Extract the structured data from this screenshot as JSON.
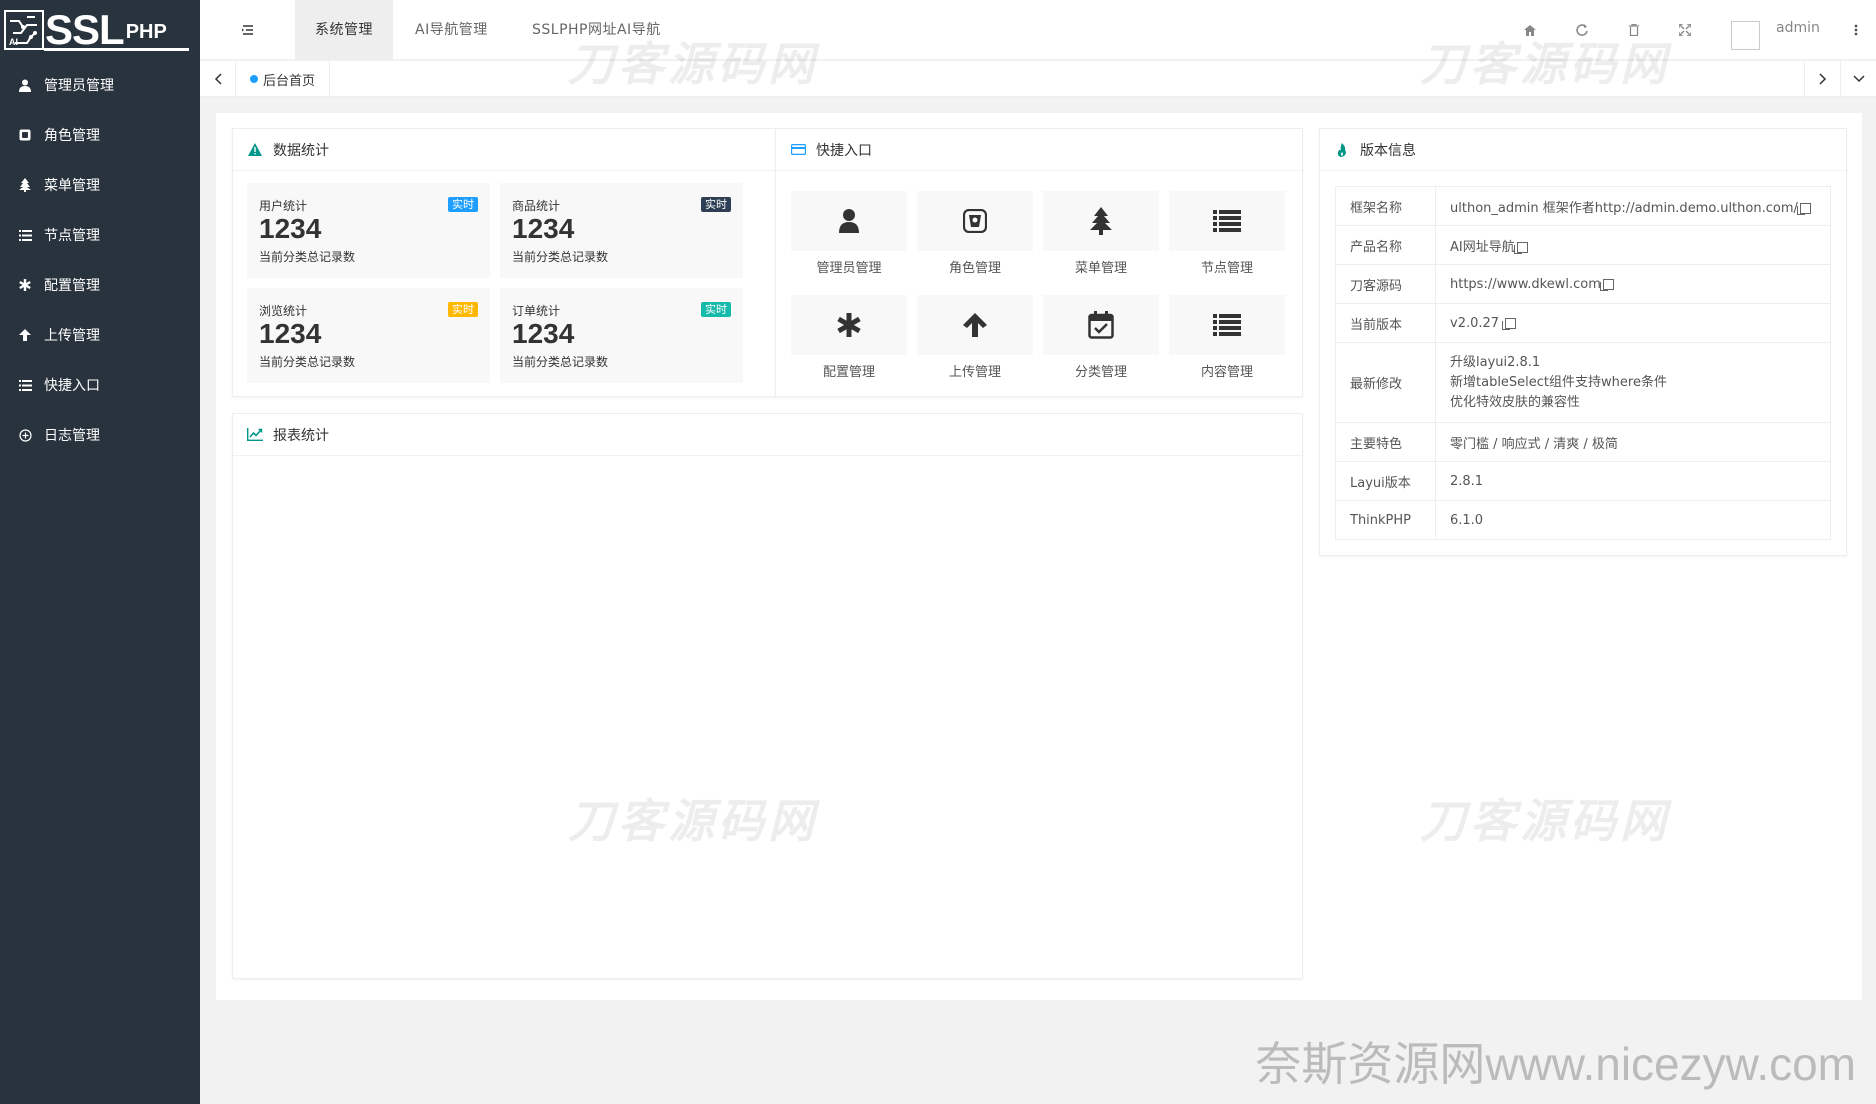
{
  "logo": {
    "main": "SSL",
    "sub": "PHP"
  },
  "sidebar": {
    "items": [
      {
        "label": "管理员管理",
        "icon": "user-icon"
      },
      {
        "label": "角色管理",
        "icon": "role-icon"
      },
      {
        "label": "菜单管理",
        "icon": "tree-icon"
      },
      {
        "label": "节点管理",
        "icon": "list-icon"
      },
      {
        "label": "配置管理",
        "icon": "asterisk-icon"
      },
      {
        "label": "上传管理",
        "icon": "arrow-up-icon"
      },
      {
        "label": "快捷入口",
        "icon": "list-icon"
      },
      {
        "label": "日志管理",
        "icon": "log-icon"
      }
    ]
  },
  "header": {
    "tabs": [
      "系统管理",
      "AI导航管理",
      "SSLPHP网址AI导航"
    ],
    "active_tab": 0,
    "username": "admin"
  },
  "tabsbar": {
    "home_tab": "后台首页"
  },
  "stats": {
    "title": "数据统计",
    "desc": "当前分类总记录数",
    "items": [
      {
        "label": "用户统计",
        "badge": "实时",
        "value": "1234",
        "color": "#1e9fff"
      },
      {
        "label": "商品统计",
        "badge": "实时",
        "value": "1234",
        "color": "#2f4056"
      },
      {
        "label": "浏览统计",
        "badge": "实时",
        "value": "1234",
        "color": "#ffb800"
      },
      {
        "label": "订单统计",
        "badge": "实时",
        "value": "1234",
        "color": "#16b777"
      }
    ]
  },
  "quick": {
    "title": "快捷入口",
    "items": [
      {
        "label": "管理员管理",
        "icon": "user-icon"
      },
      {
        "label": "角色管理",
        "icon": "role-icon"
      },
      {
        "label": "菜单管理",
        "icon": "tree-icon"
      },
      {
        "label": "节点管理",
        "icon": "list-icon"
      },
      {
        "label": "配置管理",
        "icon": "asterisk-icon"
      },
      {
        "label": "上传管理",
        "icon": "arrow-up-icon"
      },
      {
        "label": "分类管理",
        "icon": "calendar-check-icon"
      },
      {
        "label": "内容管理",
        "icon": "list-icon"
      }
    ]
  },
  "report": {
    "title": "报表统计"
  },
  "version": {
    "title": "版本信息",
    "rows": [
      {
        "key": "框架名称",
        "value": "ulthon_admin 框架作者http://admin.demo.ulthon.com/"
      },
      {
        "key": "产品名称",
        "value": "AI网址导航"
      },
      {
        "key": "刀客源码",
        "value": "https://www.dkewl.com"
      },
      {
        "key": "当前版本",
        "value": "v2.0.27"
      },
      {
        "key": "最新修改",
        "lines": [
          "升级layui2.8.1",
          "新增tableSelect组件支持where条件",
          "优化特效皮肤的兼容性"
        ]
      },
      {
        "key": "主要特色",
        "value": "零门槛 / 响应式 / 清爽 / 极简"
      },
      {
        "key": "Layui版本",
        "value": "2.8.1"
      },
      {
        "key": "ThinkPHP",
        "value": "6.1.0"
      }
    ]
  },
  "watermarks": {
    "text": "刀客源码网",
    "footer": "奈斯资源网www.nicezyw.com"
  }
}
